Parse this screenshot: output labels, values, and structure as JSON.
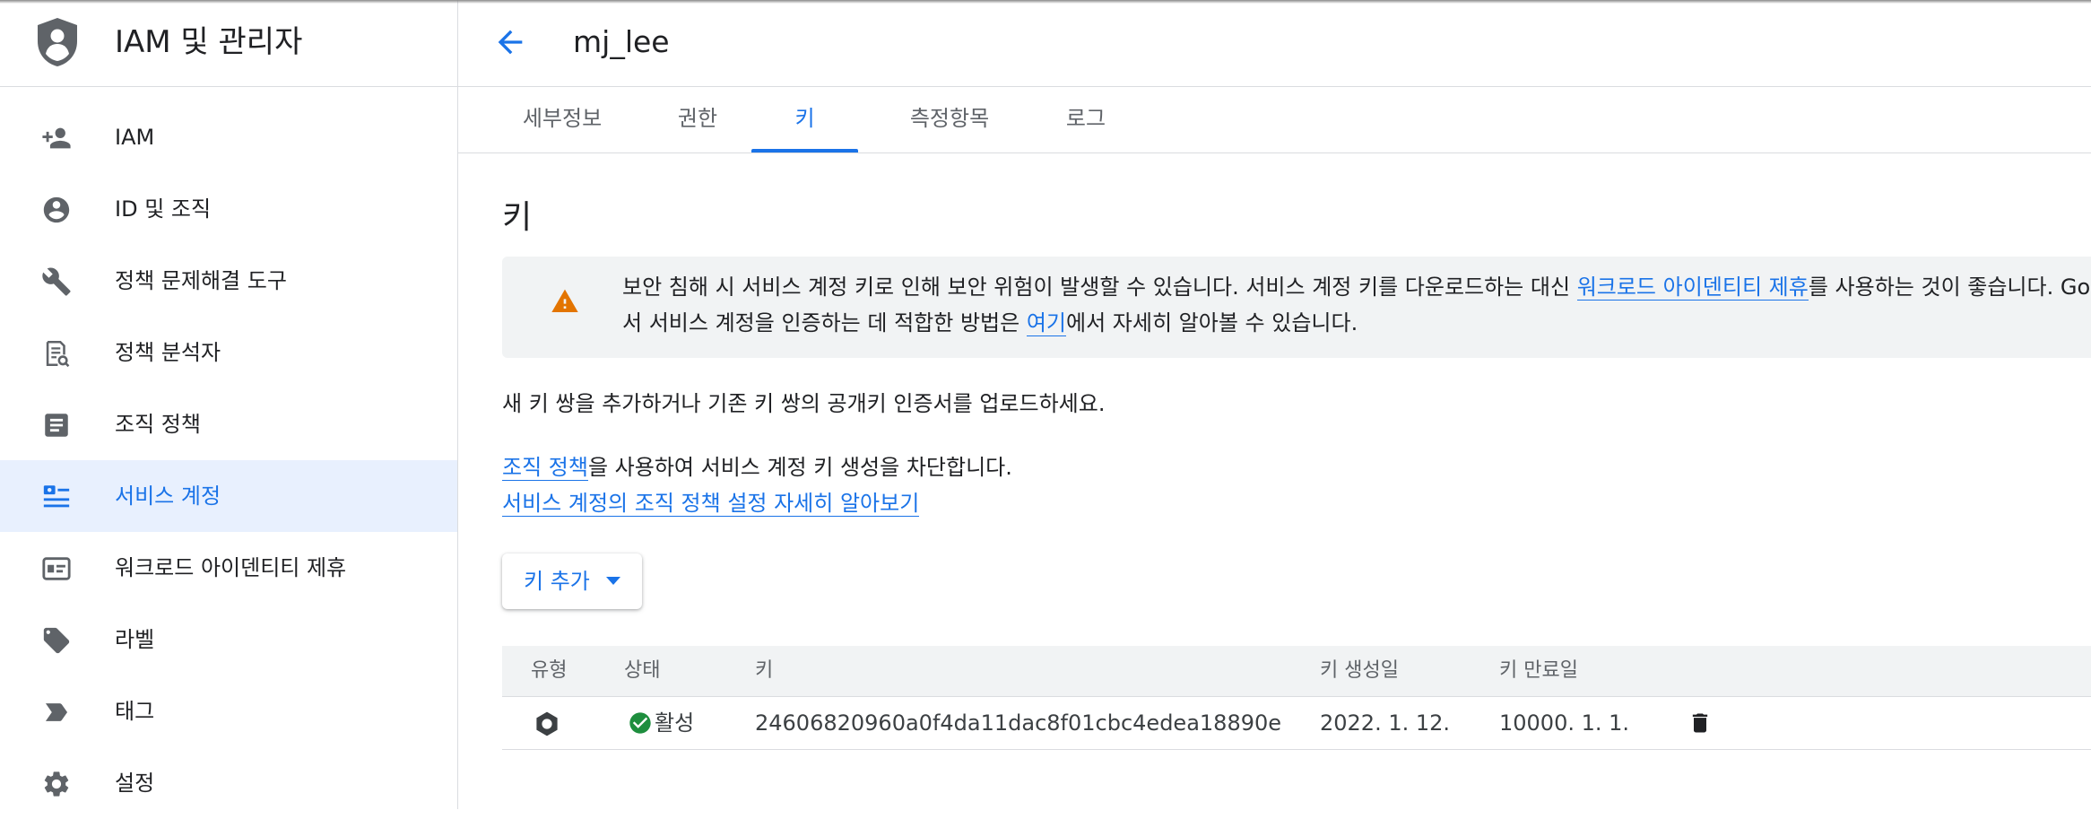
{
  "app": {
    "title": "IAM 및 관리자"
  },
  "sidebar": {
    "items": [
      {
        "label": "IAM",
        "icon": "person-add-icon"
      },
      {
        "label": "ID 및 조직",
        "icon": "account-circle-icon"
      },
      {
        "label": "정책 문제해결 도구",
        "icon": "wrench-icon"
      },
      {
        "label": "정책 분석자",
        "icon": "policy-analyzer-icon"
      },
      {
        "label": "조직 정책",
        "icon": "article-icon"
      },
      {
        "label": "서비스 계정",
        "icon": "service-account-icon",
        "active": true
      },
      {
        "label": "워크로드 아이덴티티 제휴",
        "icon": "id-card-icon"
      },
      {
        "label": "라벨",
        "icon": "tag-icon"
      },
      {
        "label": "태그",
        "icon": "label-arrow-icon"
      },
      {
        "label": "설정",
        "icon": "gear-icon"
      }
    ]
  },
  "header": {
    "title": "mj_lee",
    "back_icon": "arrow-back-icon"
  },
  "tabs": [
    {
      "label": "세부정보"
    },
    {
      "label": "권한"
    },
    {
      "label": "키",
      "active": true
    },
    {
      "label": "측정항목"
    },
    {
      "label": "로그"
    }
  ],
  "main": {
    "section_title": "키",
    "warning": {
      "line1_a": "보안 침해 시 서비스 계정 키로 인해 보안 위험이 발생할 수 있습니다. 서비스 계정 키를 다운로드하는 대신 ",
      "line1_link": "워크로드 아이덴티티 제휴",
      "line1_b": "를 사용하는 것이 좋습니다. Goo",
      "line2_a": "서 서비스 계정을 인증하는 데 적합한 방법은 ",
      "line2_link": "여기",
      "line2_b": "에서 자세히 알아볼 수 있습니다."
    },
    "intro": "새 키 쌍을 추가하거나 기존 키 쌍의 공개키 인증서를 업로드하세요.",
    "policy_link": "조직 정책",
    "policy_text": "을 사용하여 서비스 계정 키 생성을 차단합니다.",
    "learn_more": "서비스 계정의 조직 정책 설정 자세히 알아보기",
    "add_key_label": "키 추가"
  },
  "table": {
    "headers": {
      "type": "유형",
      "status": "상태",
      "key": "키",
      "created": "키 생성일",
      "expires": "키 만료일"
    },
    "rows": [
      {
        "status": "활성",
        "key": "24606820960a0f4da11dac8f01cbc4edea18890e",
        "created": "2022. 1. 12.",
        "expires": "10000. 1. 1."
      }
    ]
  },
  "colors": {
    "accent": "#1a73e8",
    "warning": "#e37400",
    "success": "#1e8e3e",
    "active_bg": "#e8f0fe"
  }
}
